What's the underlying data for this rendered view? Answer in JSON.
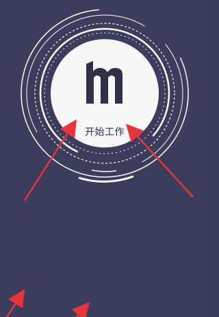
{
  "screen": {
    "background_color": "#3c3d5c",
    "ring_color": "#ffffff",
    "annotation_color": "#e8343a"
  },
  "start_button": {
    "logo_icon": "m-logo-icon",
    "label": "开始工作"
  },
  "annotations": {
    "arrows": [
      "arrow-left-upper",
      "arrow-right-upper",
      "arrow-bottom-left",
      "arrow-bottom-center"
    ]
  }
}
